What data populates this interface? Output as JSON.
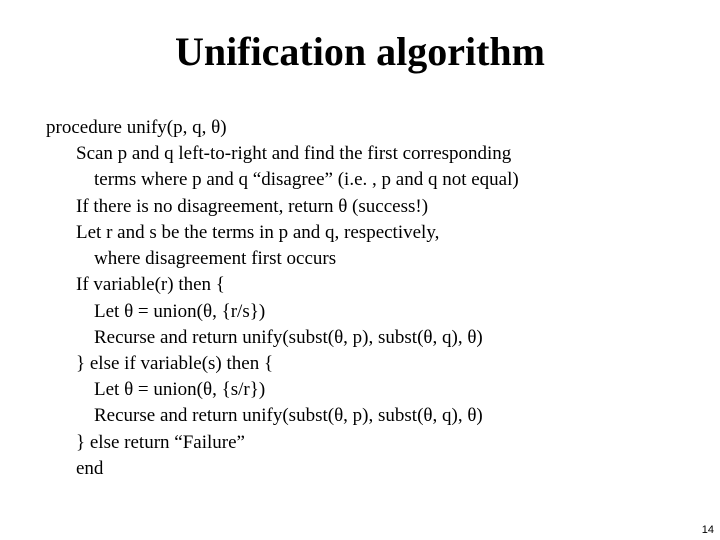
{
  "title": "Unification algorithm",
  "lines": {
    "l0": "procedure unify(p, q, θ)",
    "l1": "Scan p and q left-to-right and find the first corresponding",
    "l2": "terms where p and q “disagree” (i.e. , p and q not equal)",
    "l3": "If there is no disagreement, return θ  (success!)",
    "l4": "Let r and s be the terms in p and q, respectively,",
    "l5": "where disagreement first occurs",
    "l6": "If variable(r) then {",
    "l7": "Let θ = union(θ, {r/s})",
    "l8": "Recurse and return unify(subst(θ, p), subst(θ, q), θ)",
    "l9": "} else if variable(s) then {",
    "l10": "Let θ = union(θ, {s/r})",
    "l11": "Recurse and return unify(subst(θ, p), subst(θ, q), θ)",
    "l12": "} else return “Failure”",
    "l13": "end"
  },
  "page_number": "14"
}
